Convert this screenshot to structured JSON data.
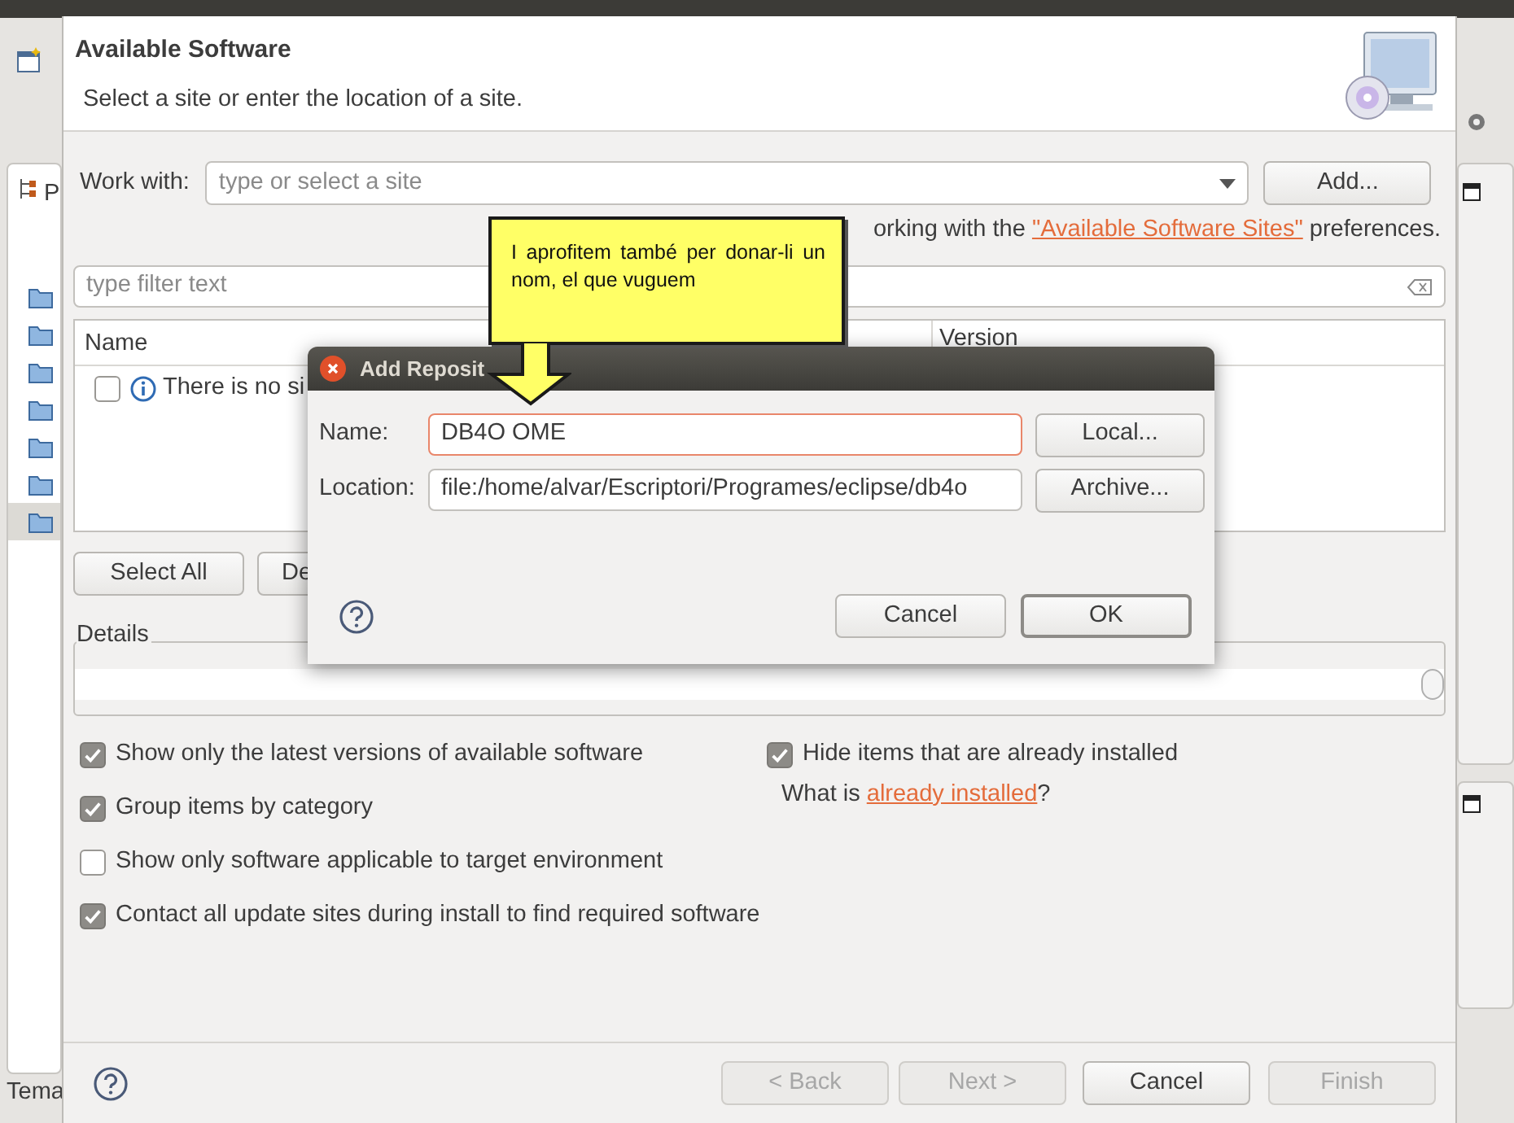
{
  "background_window": {
    "side_tab": {
      "label": "P"
    },
    "folders": [
      {
        "selected": false
      },
      {
        "selected": false
      },
      {
        "selected": false
      },
      {
        "selected": false
      },
      {
        "selected": false
      },
      {
        "selected": false
      },
      {
        "selected": true
      }
    ],
    "status_text": "Tema"
  },
  "install_dialog": {
    "title": "Available Software",
    "subtitle": "Select a site or enter the location of a site.",
    "work_with": {
      "label": "Work with:",
      "placeholder": "type or select a site",
      "add_button": "Add..."
    },
    "sites_note": {
      "before": "orking with the",
      "link": "\"Available Software Sites\"",
      "after": "preferences."
    },
    "filter": {
      "placeholder": "type filter text"
    },
    "table": {
      "columns": [
        "Name",
        "Version"
      ],
      "rows": [
        {
          "checked": false,
          "text": "There is no si"
        }
      ]
    },
    "select_all_button": "Select All",
    "deselect_button": "De",
    "details_label": "Details",
    "left_options": [
      {
        "label": "Show only the latest versions of available software",
        "checked": true
      },
      {
        "label": "Group items by category",
        "checked": true
      },
      {
        "label": "Show only software applicable to target environment",
        "checked": false
      },
      {
        "label": "Contact all update sites during install to find required software",
        "checked": true
      }
    ],
    "right_options": [
      {
        "label": "Hide items that are already installed",
        "checked": true
      }
    ],
    "installed_note": {
      "before": "What is",
      "link": "already installed",
      "after": "?"
    },
    "buttons": [
      {
        "label": "< Back",
        "disabled": true
      },
      {
        "label": "Next >",
        "disabled": true
      },
      {
        "label": "Cancel",
        "disabled": false
      },
      {
        "label": "Finish",
        "disabled": true
      }
    ]
  },
  "add_repository_dialog": {
    "title": "Add Reposit",
    "name": {
      "label": "Name:",
      "value": "DB4O OME"
    },
    "location": {
      "label": "Location:",
      "value": "file:/home/alvar/Escriptori/Programes/eclipse/db4o"
    },
    "local_button": "Local...",
    "archive_button": "Archive...",
    "buttons": [
      {
        "label": "Cancel",
        "default": false
      },
      {
        "label": "OK",
        "default": true
      }
    ]
  },
  "callout": {
    "text": "I aprofitem també per donar-li un nom, el que vuguem"
  }
}
